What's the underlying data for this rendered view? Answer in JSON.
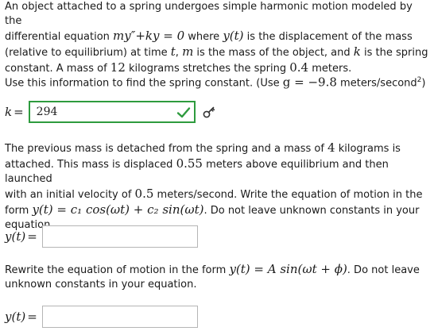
{
  "problem": {
    "intro_line1_a": "An object attached to a spring undergoes simple harmonic motion modeled by the",
    "intro_line2_a": "differential equation ",
    "intro_eq": "my″+ky = 0",
    "intro_line2_b": " where ",
    "intro_yt": "y(t)",
    "intro_line2_c": " is the displacement of the mass",
    "intro_line3_a": "(relative to equilibrium) at time ",
    "intro_t": "t",
    "intro_line3_b": ", ",
    "intro_m": "m",
    "intro_line3_c": " is the mass of the object, and ",
    "intro_k": "k",
    "intro_line3_d": " is the spring",
    "intro_line4_a": "constant. A mass of ",
    "intro_mass1": "12",
    "intro_line4_b": " kilograms stretches the spring ",
    "intro_stretch": "0.4",
    "intro_line4_c": " meters."
  },
  "spring_instruction": {
    "text_a": "Use this information to find the spring constant. (Use ",
    "g_eq": "g = −9.8",
    "text_b": " meters/second",
    "exp": "2",
    "text_c": ")"
  },
  "k_answer": {
    "label": "k",
    "eq": "=",
    "value": "294",
    "status": "correct",
    "check_color": "#2e9b3e",
    "key_icon": "key-icon"
  },
  "motion_problem": {
    "line1_a": "The previous mass is detached from the spring and a mass of ",
    "mass2": "4",
    "line1_b": " kilograms is",
    "line2_a": "attached. This mass is displaced ",
    "disp": "0.55",
    "line2_b": " meters above equilibrium and then launched",
    "line3_a": "with an initial velocity of ",
    "vel": "0.5",
    "line3_b": " meters/second. Write the equation of motion in the",
    "line4_a": "form ",
    "form_eq": "y(t) = c₁ cos(ωt) + c₂ sin(ωt)",
    "line4_b": ". Do not leave unknown constants in your",
    "line5": "equation."
  },
  "y1_answer": {
    "label": "y(t)",
    "eq": "=",
    "value": ""
  },
  "rewrite_instruction": {
    "line1_a": "Rewrite the equation of motion in the form ",
    "form_eq": "y(t) = A sin(ωt + ϕ)",
    "line1_b": ". Do not leave",
    "line2": "unknown constants in your equation."
  },
  "y2_answer": {
    "label": "y(t)",
    "eq": "=",
    "value": ""
  }
}
